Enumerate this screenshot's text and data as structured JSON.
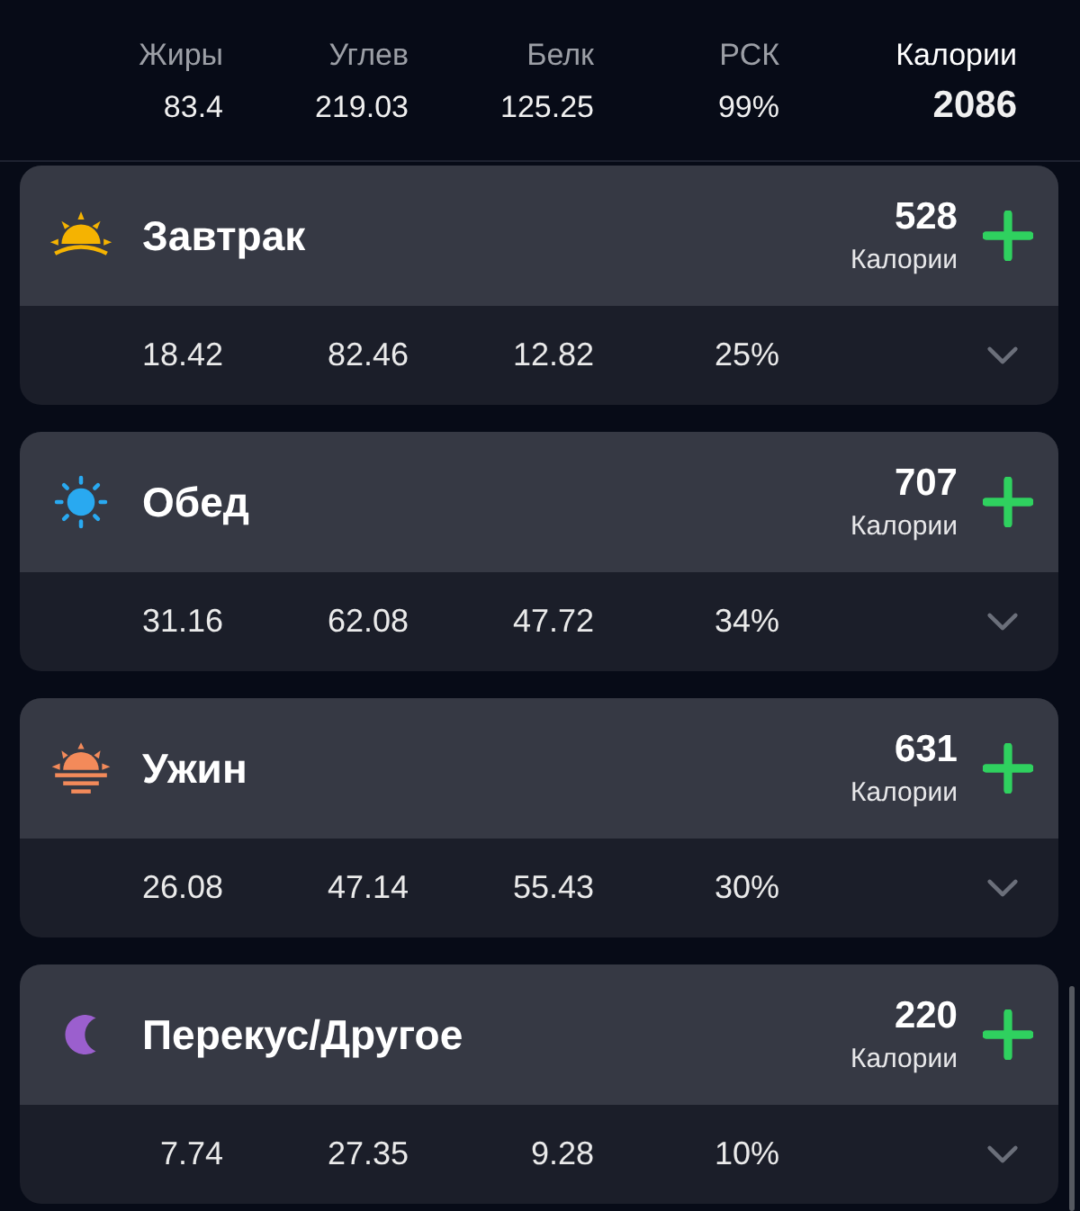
{
  "summary": {
    "columns": [
      {
        "label": "Жиры",
        "value": "83.4"
      },
      {
        "label": "Углев",
        "value": "219.03"
      },
      {
        "label": "Белк",
        "value": "125.25"
      },
      {
        "label": "РСК",
        "value": "99%"
      }
    ],
    "calories": {
      "label": "Калории",
      "value": "2086"
    }
  },
  "meals": [
    {
      "kind": "sunrise",
      "name": "Завтрак",
      "calories": "528",
      "calories_label": "Калории",
      "values": [
        "18.42",
        "82.46",
        "12.82",
        "25%"
      ]
    },
    {
      "kind": "sun",
      "name": "Обед",
      "calories": "707",
      "calories_label": "Калории",
      "values": [
        "31.16",
        "62.08",
        "47.72",
        "34%"
      ]
    },
    {
      "kind": "sunset",
      "name": "Ужин",
      "calories": "631",
      "calories_label": "Калории",
      "values": [
        "26.08",
        "47.14",
        "55.43",
        "30%"
      ]
    },
    {
      "kind": "moon",
      "name": "Перекус/Другое",
      "calories": "220",
      "calories_label": "Калории",
      "values": [
        "7.74",
        "27.35",
        "9.28",
        "10%"
      ]
    }
  ]
}
